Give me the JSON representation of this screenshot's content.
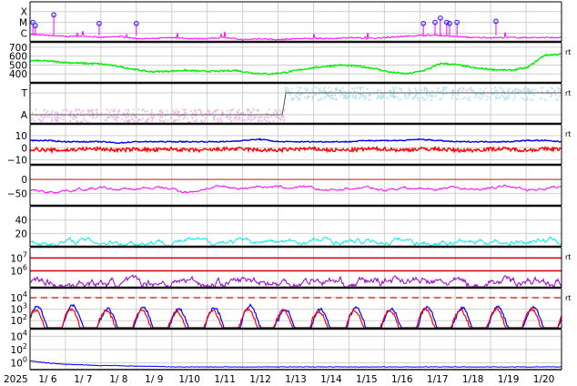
{
  "chart_data": {
    "type": "line",
    "title": "",
    "x_axis": {
      "year_label": "2025",
      "tick_labels": [
        "1/ 6",
        "1/ 7",
        "1/ 8",
        "1/ 9",
        "1/10",
        "1/11",
        "1/12",
        "1/13",
        "1/14",
        "1/15",
        "1/16",
        "1/17",
        "1/18",
        "1/19",
        "1/20"
      ],
      "range_days": [
        0,
        15
      ],
      "grid": true
    },
    "panels": [
      {
        "name": "xray-flux",
        "scale": "log",
        "ylim": [
          -6.8,
          -3.1
        ],
        "tick_labels": [
          {
            "label": "X",
            "value": -4
          },
          {
            "label": "M",
            "value": -5
          },
          {
            "label": "C",
            "value": -6
          }
        ],
        "series": [
          {
            "name": "xray",
            "color": "#ff00ff",
            "values": [
              -6.1,
              -6.2,
              -6.3,
              -6.25,
              -6.4,
              -6.3,
              -6.5,
              -6.5,
              -6.4,
              -6.5,
              -6.5,
              -6.4,
              -6.6,
              -6.5,
              -6.6,
              -6.5,
              -6.5,
              -6.5,
              -6.4,
              -6.5,
              -6.4,
              -6.3,
              -6.2,
              -6.2,
              -6.3,
              -6.4,
              -6.4,
              -6.4,
              -6.4,
              -6.4,
              -6.4
            ]
          }
        ],
        "flares": [
          {
            "day": 0.08,
            "level": -5.0
          },
          {
            "day": 0.15,
            "level": -5.3
          },
          {
            "day": 0.67,
            "level": -4.3
          },
          {
            "day": 1.95,
            "level": -5.1
          },
          {
            "day": 3.0,
            "level": -5.1
          },
          {
            "day": 11.1,
            "level": -5.1
          },
          {
            "day": 11.43,
            "level": -5.0
          },
          {
            "day": 11.58,
            "level": -4.6
          },
          {
            "day": 11.76,
            "level": -5.0
          },
          {
            "day": 11.84,
            "level": -5.1
          },
          {
            "day": 12.05,
            "level": -5.0
          },
          {
            "day": 13.15,
            "level": -4.9
          }
        ],
        "flare_color": "#3333ff"
      },
      {
        "name": "solar-wind-speed",
        "scale": "linear",
        "ylim": [
          300,
          750
        ],
        "tick_labels": [
          {
            "label": "700",
            "value": 700
          },
          {
            "label": "600",
            "value": 600
          },
          {
            "label": "500",
            "value": 500
          },
          {
            "label": "400",
            "value": 400
          }
        ],
        "rt_label": "rt",
        "series": [
          {
            "name": "speed",
            "color": "#00ee00",
            "values": [
              550,
              545,
              530,
              520,
              515,
              490,
              455,
              425,
              430,
              440,
              430,
              430,
              440,
              410,
              400,
              420,
              455,
              480,
              500,
              490,
              465,
              420,
              400,
              440,
              520,
              500,
              465,
              450,
              440,
              470,
              610,
              625
            ]
          }
        ]
      },
      {
        "name": "imf-sector",
        "scale": "category",
        "tick_labels": [
          {
            "label": "T",
            "value": 1
          },
          {
            "label": "A",
            "value": -1
          }
        ],
        "rt_label": "rt",
        "sector_change_day": 7.17,
        "colors": {
          "toward": "#aee6ff",
          "away": "#f7b3ef",
          "gray": "#cccccc",
          "line": "#555555"
        }
      },
      {
        "name": "imf-field",
        "scale": "linear",
        "ylim": [
          -14,
          19
        ],
        "tick_labels": [
          {
            "label": "10",
            "value": 10
          },
          {
            "label": "0",
            "value": 0
          },
          {
            "label": "−10",
            "value": -10
          }
        ],
        "rt_label": "rt",
        "series": [
          {
            "name": "Bt",
            "color": "#0000ff",
            "values": [
              6,
              6,
              5,
              5,
              5,
              4,
              5,
              5,
              5,
              5,
              5,
              5,
              6,
              7,
              5,
              5,
              5,
              5,
              5,
              6,
              6,
              6,
              7,
              6,
              5,
              5,
              5,
              5,
              6,
              6,
              5
            ]
          },
          {
            "name": "Bz",
            "color": "#ff0000",
            "values": [
              -1,
              -2,
              -2,
              -1,
              -1,
              -2,
              -1,
              -2,
              -1,
              -2,
              -2,
              -1,
              -1,
              -2,
              -2,
              -1,
              -1,
              -2,
              -2,
              -1,
              -1,
              -2,
              -1,
              -1,
              -2,
              -2,
              -1,
              -1,
              -2,
              -1,
              -1
            ]
          }
        ]
      },
      {
        "name": "dst-index",
        "scale": "linear",
        "ylim": [
          -95,
          50
        ],
        "tick_labels": [
          {
            "label": "0",
            "value": 0
          },
          {
            "label": "−50",
            "value": -50
          }
        ],
        "ref_line": {
          "value": 0,
          "color": "#cc6666"
        },
        "series": [
          {
            "name": "dst",
            "color": "#ff00ff",
            "values": [
              -40,
              -45,
              -38,
              -35,
              -32,
              -38,
              -35,
              -30,
              -35,
              -45,
              -30,
              -28,
              -32,
              -22,
              -30,
              -28,
              -35,
              -40,
              -32,
              -30,
              -38,
              -28,
              -32,
              -35,
              -25,
              -40,
              -30,
              -25,
              -38,
              -30,
              -28
            ]
          }
        ]
      },
      {
        "name": "kp-index",
        "scale": "linear",
        "ylim": [
          0,
          60
        ],
        "tick_labels": [
          {
            "label": "40",
            "value": 40
          },
          {
            "label": "20",
            "value": 20
          }
        ],
        "series": [
          {
            "name": "kp",
            "color": "#00eeee",
            "values": [
              10,
              6,
              7,
              9,
              7,
              8,
              6,
              8,
              7,
              9,
              6,
              8,
              7,
              8,
              7,
              6,
              8,
              9,
              6,
              7,
              8,
              10,
              7,
              6,
              8,
              7,
              9,
              7,
              8,
              10,
              8
            ]
          }
        ]
      },
      {
        "name": "electron-flux",
        "scale": "log",
        "ylim": [
          4.7,
          7.8
        ],
        "tick_labels": [
          {
            "label": "10",
            "exp": "7",
            "value": 7
          },
          {
            "label": "10",
            "exp": "6",
            "value": 6
          }
        ],
        "rt_label": "rt",
        "ref_lines": [
          {
            "value": 7,
            "color": "#cc0000"
          },
          {
            "value": 6,
            "color": "#cc0000"
          }
        ],
        "series": [
          {
            "name": "electrons",
            "color": "#9900cc",
            "values": [
              5.2,
              5.1,
              4.9,
              5.2,
              5.0,
              5.1,
              4.9,
              5.2,
              5.1,
              5.3,
              5.0,
              5.1,
              5.2,
              5.3,
              5.0,
              5.1,
              5.3,
              5.2,
              5.0,
              5.1,
              5.3,
              5.4,
              5.2,
              5.0,
              5.1,
              4.9,
              5.2,
              5.1,
              5.3,
              5.2,
              5.1
            ]
          }
        ]
      },
      {
        "name": "proton-flux",
        "scale": "log",
        "ylim": [
          1.3,
          4.8
        ],
        "tick_labels": [
          {
            "label": "10",
            "exp": "4",
            "value": 4
          },
          {
            "label": "10",
            "exp": "3",
            "value": 3
          },
          {
            "label": "10",
            "exp": "2",
            "value": 2
          }
        ],
        "rt_label": "rt",
        "ref_line": {
          "value": 4,
          "color": "#dd3333",
          "dashed": true
        },
        "series": [
          {
            "name": "blue",
            "color": "#0000ff",
            "daily_peak": [
              3.2,
              3.3,
              3.0,
              3.1,
              3.0,
              3.1,
              3.3,
              3.0,
              3.0,
              3.1,
              3.0,
              3.2,
              3.1,
              3.2,
              3.2
            ]
          },
          {
            "name": "red",
            "color": "#ff0000",
            "daily_peak": [
              2.9,
              3.0,
              2.9,
              2.9,
              2.8,
              2.9,
              3.0,
              2.9,
              2.8,
              2.9,
              2.9,
              3.0,
              2.9,
              3.0,
              3.0
            ]
          }
        ]
      },
      {
        "name": "high-energy-flux",
        "scale": "log",
        "ylim": [
          -1,
          5
        ],
        "tick_labels": [
          {
            "label": "10",
            "exp": "4",
            "value": 4
          },
          {
            "label": "10",
            "exp": "2",
            "value": 2
          },
          {
            "label": "10",
            "exp": "0",
            "value": 0
          }
        ],
        "series": [
          {
            "name": "flux",
            "color": "#0000ff",
            "values": [
              0.3,
              0.0,
              -0.2,
              -0.3,
              -0.4,
              -0.4,
              -0.5,
              -0.5,
              -0.6,
              -0.6,
              -0.6,
              -0.6,
              -0.6,
              -0.6,
              -0.6,
              -0.6,
              -0.6,
              -0.6,
              -0.6,
              -0.6,
              -0.6,
              -0.6,
              -0.6,
              -0.6,
              -0.6,
              -0.6,
              -0.6,
              -0.6,
              -0.6,
              -0.6,
              -0.6
            ]
          }
        ]
      }
    ]
  }
}
